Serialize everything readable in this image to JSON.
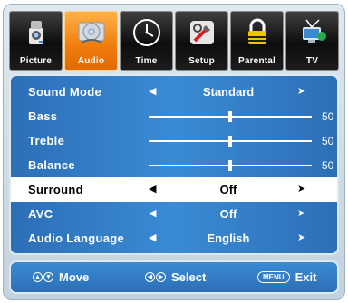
{
  "tabs": [
    {
      "label": "Picture",
      "icon": "camera-icon",
      "active": false
    },
    {
      "label": "Audio",
      "icon": "audio-disc-icon",
      "active": true
    },
    {
      "label": "Time",
      "icon": "clock-icon",
      "active": false
    },
    {
      "label": "Setup",
      "icon": "tools-icon",
      "active": false
    },
    {
      "label": "Parental",
      "icon": "lock-icon",
      "active": false
    },
    {
      "label": "TV",
      "icon": "antenna-tv-icon",
      "active": false
    }
  ],
  "menu": {
    "sound_mode": {
      "label": "Sound Mode",
      "value": "Standard"
    },
    "bass": {
      "label": "Bass",
      "value": "50",
      "level": 0.5
    },
    "treble": {
      "label": "Treble",
      "value": "50",
      "level": 0.5
    },
    "balance": {
      "label": "Balance",
      "value": "50",
      "level": 0.5
    },
    "surround": {
      "label": "Surround",
      "value": "Off",
      "selected": true
    },
    "avc": {
      "label": "AVC",
      "value": "Off"
    },
    "audio_language": {
      "label": "Audio Language",
      "value": "English"
    }
  },
  "footer": {
    "move": "Move",
    "select": "Select",
    "menu_key": "MENU",
    "exit": "Exit"
  },
  "colors": {
    "panel_blue": "#3a8bd4",
    "active_tab_orange": "#f07c0c",
    "tab_black": "#1c1c1c",
    "selected_row": "#ffffff"
  }
}
